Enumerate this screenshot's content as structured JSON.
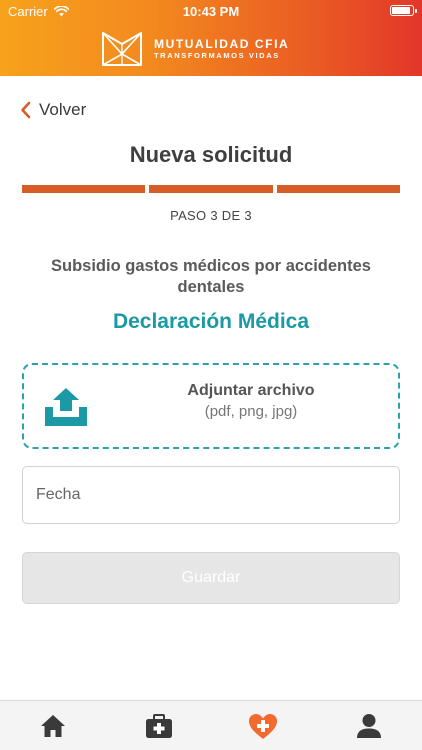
{
  "status_bar": {
    "carrier": "Carrier",
    "time": "10:43 PM",
    "icons": [
      "wifi-icon",
      "battery-icon"
    ]
  },
  "brand": {
    "name": "MUTUALIDAD CFIA",
    "tagline": "TRANSFORMAMOS VIDAS",
    "logo_icon": "mutualidad-logo"
  },
  "nav": {
    "back_label": "Volver",
    "back_icon": "chevron-left-icon"
  },
  "page": {
    "title": "Nueva solicitud",
    "progress": {
      "current_step": 3,
      "total_steps": 3,
      "label": "PASO 3 DE 3"
    },
    "subtitle": "Subsidio gastos médicos por accidentes dentales",
    "section_title": "Declaración Médica"
  },
  "upload": {
    "icon": "upload-tray-icon",
    "title": "Adjuntar archivo",
    "formats": "(pdf, png, jpg)"
  },
  "form": {
    "date_placeholder": "Fecha",
    "date_value": "",
    "save_label": "Guardar"
  },
  "tab_bar": {
    "items": [
      {
        "icon": "home-icon",
        "active": false
      },
      {
        "icon": "medical-kit-icon",
        "active": false
      },
      {
        "icon": "heart-plus-icon",
        "active": true
      },
      {
        "icon": "profile-icon",
        "active": false
      }
    ]
  },
  "colors": {
    "header_gradient": [
      "#f7a21c",
      "#e2362a"
    ],
    "accent_orange": "#d75d26",
    "accent_teal": "#1b9aa5",
    "tab_active": "#f26a2e",
    "tab_inactive": "#3a3a3a"
  }
}
